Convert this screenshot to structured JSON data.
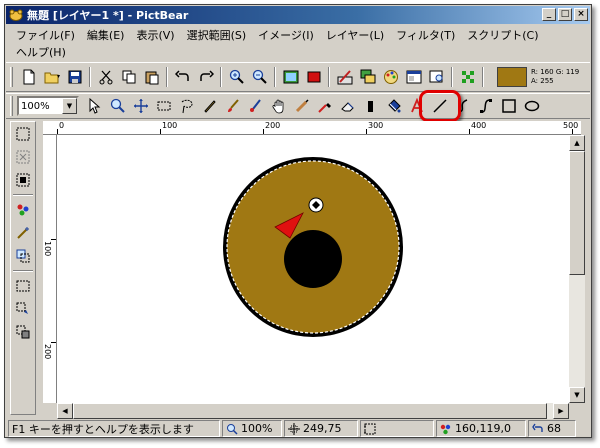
{
  "window": {
    "title": "無題 [レイヤー1 *] - PictBear",
    "minimize": "_",
    "maximize": "□",
    "close": "×"
  },
  "menu": [
    "ファイル(F)",
    "編集(E)",
    "表示(V)",
    "選択範囲(S)",
    "イメージ(I)",
    "レイヤー(L)",
    "フィルタ(T)",
    "スクリプト(C)",
    "ヘルプ(H)"
  ],
  "color": {
    "current_hex": "#a07813",
    "r": "R: 160",
    "g": "G: 119",
    "a": "A: 255"
  },
  "zoom_select": {
    "value": "100%"
  },
  "ruler": {
    "h_labels": [
      "0",
      "100",
      "200",
      "300",
      "400",
      "500"
    ],
    "v_labels": [
      "100",
      "200"
    ]
  },
  "statusbar": {
    "message": "F1 キーを押すとヘルプを表示します",
    "zoom": "100%",
    "cursor_pos": "249,75",
    "selection_size": "",
    "color_value": "160,119,0",
    "undo_count": "68"
  },
  "icons": {
    "toolbar1": [
      "new-icon",
      "open-icon",
      "save-icon",
      "cut-icon",
      "copy-icon",
      "paste-icon",
      "undo-icon",
      "redo-icon",
      "zoom-in-icon",
      "zoom-out-icon",
      "image-icon",
      "red-rect-icon",
      "brush-palette-icon",
      "layers-icon",
      "palette-icon",
      "window-icon",
      "search-window-icon",
      "grid-icon"
    ],
    "toolbar2": [
      "pointer-icon",
      "zoom-icon",
      "move-icon",
      "rect-select-icon",
      "lasso-icon",
      "pen-icon",
      "brush-icon",
      "airbrush-icon",
      "hand-icon",
      "smudge-icon",
      "dropper-icon",
      "eraser-icon",
      "bucket-icon",
      "fill-icon",
      "text-icon",
      "line-icon",
      "curve-icon",
      "bezier-icon",
      "rectangle-icon",
      "ellipse-icon"
    ],
    "colors": {
      "accent": "#a07813",
      "highlight": "#e00000",
      "title_bar": "#0a246a"
    }
  }
}
